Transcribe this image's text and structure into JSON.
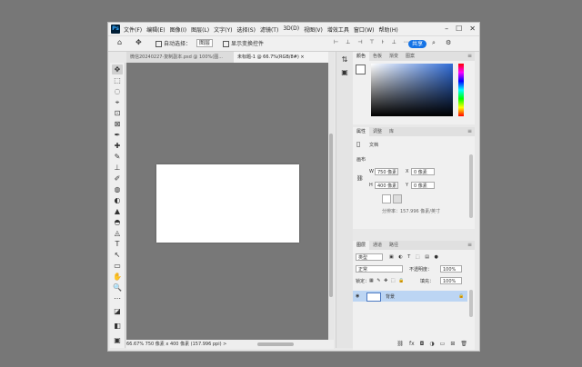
{
  "app": {
    "logo": "Ps"
  },
  "menu": [
    "文件(F)",
    "编辑(E)",
    "图像(I)",
    "图层(L)",
    "文字(Y)",
    "选择(S)",
    "滤镜(T)",
    "3D(D)",
    "视图(V)",
    "增效工具",
    "窗口(W)",
    "帮助(H)"
  ],
  "window_buttons": {
    "min": "–",
    "max": "☐",
    "close": "✕"
  },
  "options": {
    "auto_select": "自动选择：",
    "auto_select_value": "图层",
    "show_transform": "显示变换控件",
    "share_label": "共享",
    "home_icon": "⌂",
    "move_icon": "✥",
    "search_icon": "⌕",
    "gear_icon": "⚙",
    "align_icons": "⊢ ⊥ ⊣ ⊤ ⊦ ⊥ ⋯"
  },
  "tabs": [
    {
      "label": "微信20240227-复制副本.psd @ 100%(图...",
      "close": "×"
    },
    {
      "label": "未标题-1 @ 66.7%(RGB/8#)",
      "close": "×"
    }
  ],
  "tools": [
    "✥",
    "⬚",
    "◌",
    "⌖",
    "⊡",
    "⊠",
    "✒",
    "✚",
    "✎",
    "⊥",
    "✐",
    "◍",
    "◐",
    "▲",
    "◓",
    "◬",
    "T",
    "↖",
    "▭",
    "✋",
    "🔍",
    "⋯",
    "◪",
    "◧",
    "▣"
  ],
  "status": {
    "zoom": "66.67%",
    "info": "750 像素 x 400 像素 (157.996 ppi)",
    "arrow": ">"
  },
  "dock": {
    "history_icon": "⇅",
    "comment_icon": "▣"
  },
  "color_panel": {
    "tabs": [
      "颜色",
      "色板",
      "渐变",
      "图案"
    ],
    "menu": "≡"
  },
  "properties_panel": {
    "tabs": [
      "属性",
      "调整",
      "库"
    ],
    "type_icon": "▯",
    "type_label": "文档",
    "canvas_header": "画布",
    "w_label": "W",
    "w_value": "750 像素",
    "h_label": "H",
    "h_value": "400 像素",
    "x_label": "X",
    "x_value": "0 像素",
    "y_label": "Y",
    "y_value": "0 像素",
    "resolution": "分辨率：157.996 像素/英寸",
    "link_icon": "⛓",
    "menu": "≡"
  },
  "layers_panel": {
    "tabs": [
      "图层",
      "通道",
      "路径"
    ],
    "menu": "≡",
    "search_placeholder": "类型",
    "blend_mode": "正常",
    "opacity_label": "不透明度：",
    "opacity_value": "100%",
    "lock_label": "锁定：",
    "fill_label": "填充：",
    "fill_value": "100%",
    "layer_name": "背景",
    "eye_icon": "◉",
    "lock_icon": "🔒",
    "filter_icons": "▣ ◐ T ⬚ ▤ ●",
    "lock_icons": "▦ ✎ ✥ ⬚ 🔒",
    "bottom_icons": [
      "⛓",
      "fx",
      "◘",
      "◑",
      "▭",
      "⊞",
      "🗑"
    ]
  }
}
